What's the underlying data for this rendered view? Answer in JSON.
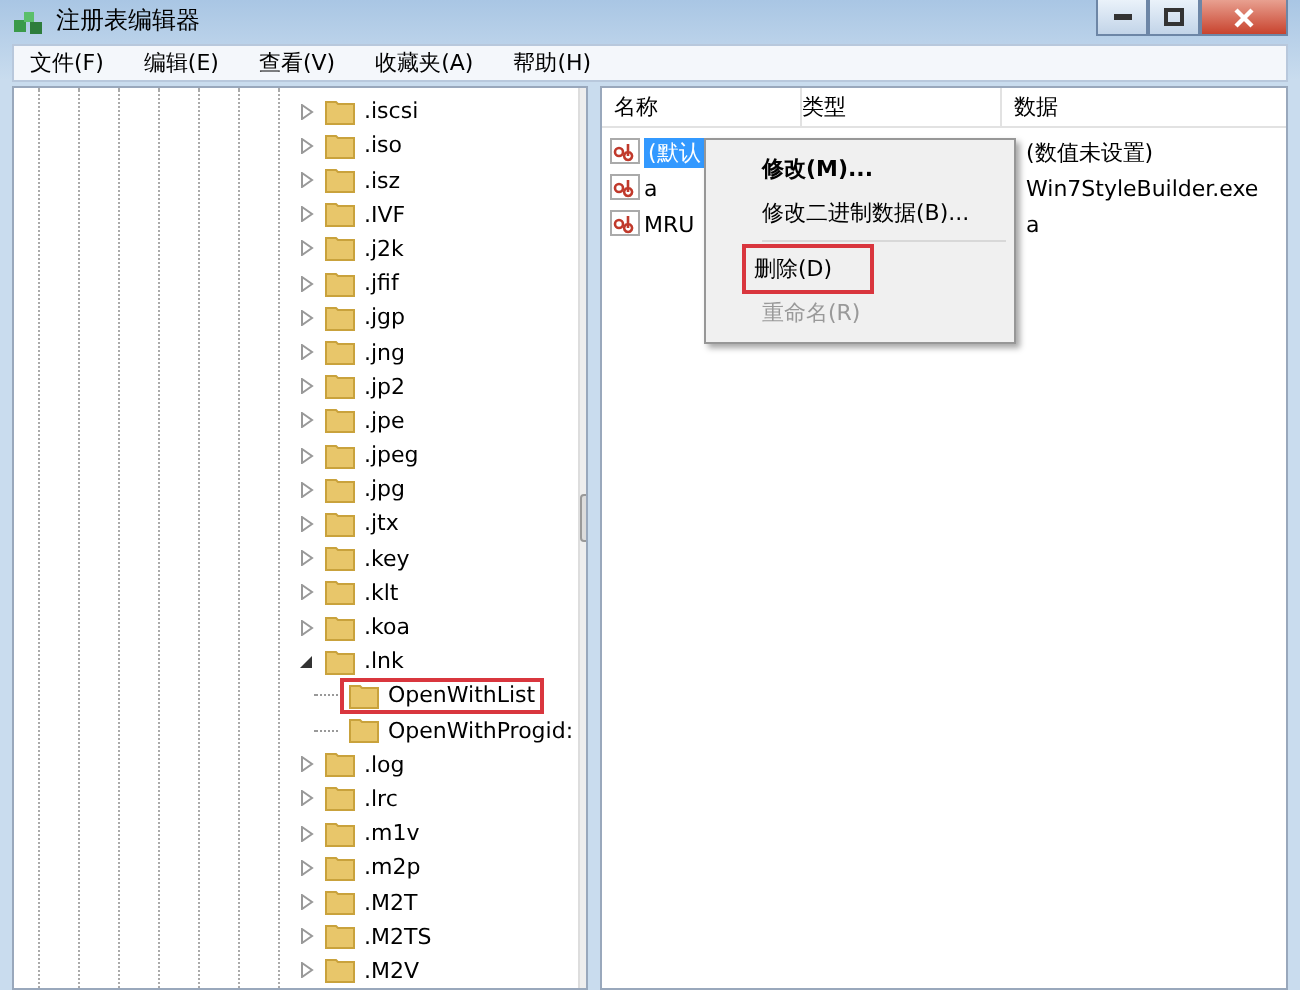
{
  "window": {
    "title": "注册表编辑器"
  },
  "menu": [
    "文件(F)",
    "编辑(E)",
    "查看(V)",
    "收藏夹(A)",
    "帮助(H)"
  ],
  "tree": [
    {
      "label": ".iscsi",
      "expanded": false
    },
    {
      "label": ".iso",
      "expanded": false
    },
    {
      "label": ".isz",
      "expanded": false
    },
    {
      "label": ".IVF",
      "expanded": false
    },
    {
      "label": ".j2k",
      "expanded": false
    },
    {
      "label": ".jfif",
      "expanded": false
    },
    {
      "label": ".jgp",
      "expanded": false
    },
    {
      "label": ".jng",
      "expanded": false
    },
    {
      "label": ".jp2",
      "expanded": false
    },
    {
      "label": ".jpe",
      "expanded": false
    },
    {
      "label": ".jpeg",
      "expanded": false
    },
    {
      "label": ".jpg",
      "expanded": false
    },
    {
      "label": ".jtx",
      "expanded": false
    },
    {
      "label": ".key",
      "expanded": false
    },
    {
      "label": ".klt",
      "expanded": false
    },
    {
      "label": ".koa",
      "expanded": false
    },
    {
      "label": ".lnk",
      "expanded": true,
      "children": [
        {
          "label": "OpenWithList",
          "annotated": true
        },
        {
          "label": "OpenWithProgid:",
          "annotated": false
        }
      ]
    },
    {
      "label": ".log",
      "expanded": false
    },
    {
      "label": ".lrc",
      "expanded": false
    },
    {
      "label": ".m1v",
      "expanded": false
    },
    {
      "label": ".m2p",
      "expanded": false
    },
    {
      "label": ".M2T",
      "expanded": false
    },
    {
      "label": ".M2TS",
      "expanded": false
    },
    {
      "label": ".M2V",
      "expanded": false
    }
  ],
  "table": {
    "columns": [
      "名称",
      "类型",
      "数据"
    ],
    "rows": [
      {
        "name": "(默认",
        "data": "(数值未设置)",
        "selected": true
      },
      {
        "name": "a",
        "data": "Win7StyleBuilder.exe",
        "selected": false
      },
      {
        "name": "MRU",
        "data": "a",
        "selected": false
      }
    ]
  },
  "context_menu": [
    {
      "label": "修改(M)...",
      "bold": true,
      "disabled": false,
      "annotated": false,
      "separator_before": false
    },
    {
      "label": "修改二进制数据(B)...",
      "bold": false,
      "disabled": false,
      "annotated": false,
      "separator_before": false
    },
    {
      "label": "删除(D)",
      "bold": false,
      "disabled": false,
      "annotated": true,
      "separator_before": true
    },
    {
      "label": "重命名(R)",
      "bold": false,
      "disabled": true,
      "annotated": false,
      "separator_before": false
    }
  ]
}
